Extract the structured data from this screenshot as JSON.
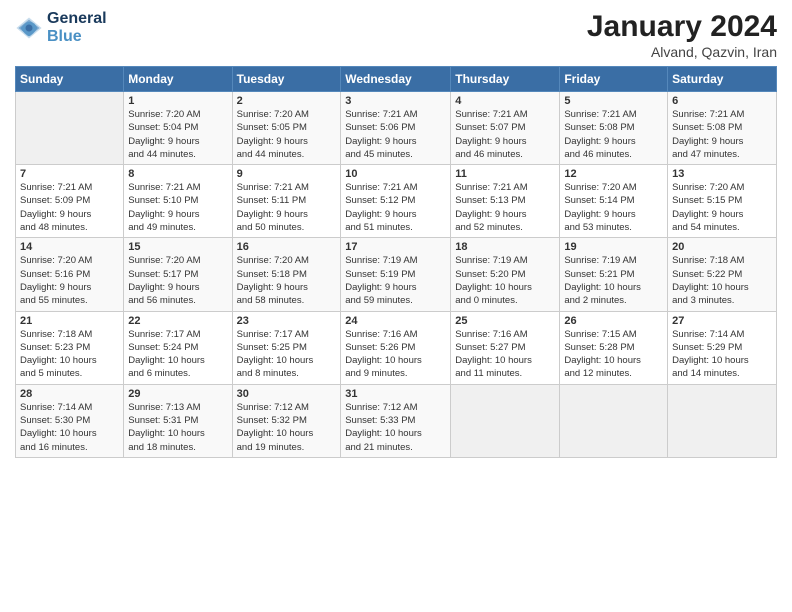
{
  "logo": {
    "line1": "General",
    "line2": "Blue"
  },
  "title": "January 2024",
  "location": "Alvand, Qazvin, Iran",
  "days_header": [
    "Sunday",
    "Monday",
    "Tuesday",
    "Wednesday",
    "Thursday",
    "Friday",
    "Saturday"
  ],
  "weeks": [
    [
      {
        "day": "",
        "info": ""
      },
      {
        "day": "1",
        "info": "Sunrise: 7:20 AM\nSunset: 5:04 PM\nDaylight: 9 hours\nand 44 minutes."
      },
      {
        "day": "2",
        "info": "Sunrise: 7:20 AM\nSunset: 5:05 PM\nDaylight: 9 hours\nand 44 minutes."
      },
      {
        "day": "3",
        "info": "Sunrise: 7:21 AM\nSunset: 5:06 PM\nDaylight: 9 hours\nand 45 minutes."
      },
      {
        "day": "4",
        "info": "Sunrise: 7:21 AM\nSunset: 5:07 PM\nDaylight: 9 hours\nand 46 minutes."
      },
      {
        "day": "5",
        "info": "Sunrise: 7:21 AM\nSunset: 5:08 PM\nDaylight: 9 hours\nand 46 minutes."
      },
      {
        "day": "6",
        "info": "Sunrise: 7:21 AM\nSunset: 5:08 PM\nDaylight: 9 hours\nand 47 minutes."
      }
    ],
    [
      {
        "day": "7",
        "info": "Sunrise: 7:21 AM\nSunset: 5:09 PM\nDaylight: 9 hours\nand 48 minutes."
      },
      {
        "day": "8",
        "info": "Sunrise: 7:21 AM\nSunset: 5:10 PM\nDaylight: 9 hours\nand 49 minutes."
      },
      {
        "day": "9",
        "info": "Sunrise: 7:21 AM\nSunset: 5:11 PM\nDaylight: 9 hours\nand 50 minutes."
      },
      {
        "day": "10",
        "info": "Sunrise: 7:21 AM\nSunset: 5:12 PM\nDaylight: 9 hours\nand 51 minutes."
      },
      {
        "day": "11",
        "info": "Sunrise: 7:21 AM\nSunset: 5:13 PM\nDaylight: 9 hours\nand 52 minutes."
      },
      {
        "day": "12",
        "info": "Sunrise: 7:20 AM\nSunset: 5:14 PM\nDaylight: 9 hours\nand 53 minutes."
      },
      {
        "day": "13",
        "info": "Sunrise: 7:20 AM\nSunset: 5:15 PM\nDaylight: 9 hours\nand 54 minutes."
      }
    ],
    [
      {
        "day": "14",
        "info": "Sunrise: 7:20 AM\nSunset: 5:16 PM\nDaylight: 9 hours\nand 55 minutes."
      },
      {
        "day": "15",
        "info": "Sunrise: 7:20 AM\nSunset: 5:17 PM\nDaylight: 9 hours\nand 56 minutes."
      },
      {
        "day": "16",
        "info": "Sunrise: 7:20 AM\nSunset: 5:18 PM\nDaylight: 9 hours\nand 58 minutes."
      },
      {
        "day": "17",
        "info": "Sunrise: 7:19 AM\nSunset: 5:19 PM\nDaylight: 9 hours\nand 59 minutes."
      },
      {
        "day": "18",
        "info": "Sunrise: 7:19 AM\nSunset: 5:20 PM\nDaylight: 10 hours\nand 0 minutes."
      },
      {
        "day": "19",
        "info": "Sunrise: 7:19 AM\nSunset: 5:21 PM\nDaylight: 10 hours\nand 2 minutes."
      },
      {
        "day": "20",
        "info": "Sunrise: 7:18 AM\nSunset: 5:22 PM\nDaylight: 10 hours\nand 3 minutes."
      }
    ],
    [
      {
        "day": "21",
        "info": "Sunrise: 7:18 AM\nSunset: 5:23 PM\nDaylight: 10 hours\nand 5 minutes."
      },
      {
        "day": "22",
        "info": "Sunrise: 7:17 AM\nSunset: 5:24 PM\nDaylight: 10 hours\nand 6 minutes."
      },
      {
        "day": "23",
        "info": "Sunrise: 7:17 AM\nSunset: 5:25 PM\nDaylight: 10 hours\nand 8 minutes."
      },
      {
        "day": "24",
        "info": "Sunrise: 7:16 AM\nSunset: 5:26 PM\nDaylight: 10 hours\nand 9 minutes."
      },
      {
        "day": "25",
        "info": "Sunrise: 7:16 AM\nSunset: 5:27 PM\nDaylight: 10 hours\nand 11 minutes."
      },
      {
        "day": "26",
        "info": "Sunrise: 7:15 AM\nSunset: 5:28 PM\nDaylight: 10 hours\nand 12 minutes."
      },
      {
        "day": "27",
        "info": "Sunrise: 7:14 AM\nSunset: 5:29 PM\nDaylight: 10 hours\nand 14 minutes."
      }
    ],
    [
      {
        "day": "28",
        "info": "Sunrise: 7:14 AM\nSunset: 5:30 PM\nDaylight: 10 hours\nand 16 minutes."
      },
      {
        "day": "29",
        "info": "Sunrise: 7:13 AM\nSunset: 5:31 PM\nDaylight: 10 hours\nand 18 minutes."
      },
      {
        "day": "30",
        "info": "Sunrise: 7:12 AM\nSunset: 5:32 PM\nDaylight: 10 hours\nand 19 minutes."
      },
      {
        "day": "31",
        "info": "Sunrise: 7:12 AM\nSunset: 5:33 PM\nDaylight: 10 hours\nand 21 minutes."
      },
      {
        "day": "",
        "info": ""
      },
      {
        "day": "",
        "info": ""
      },
      {
        "day": "",
        "info": ""
      }
    ]
  ]
}
